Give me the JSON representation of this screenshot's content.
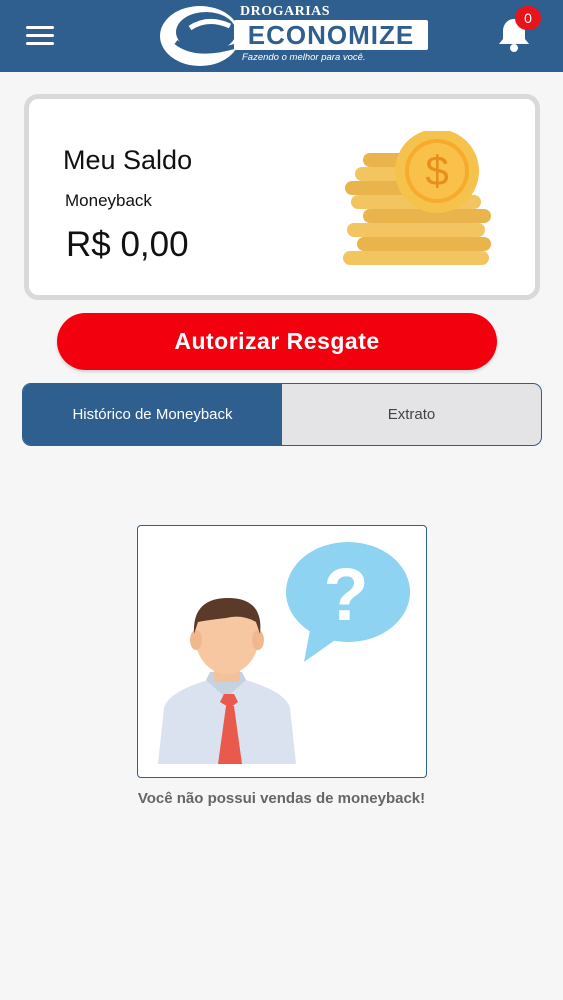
{
  "header": {
    "logo": {
      "top_text": "DROGARIAS",
      "main_text": "ECONOMIZE",
      "tagline": "Fazendo o melhor para você."
    },
    "notification_count": "0",
    "icons": [
      "menu-icon",
      "bell-icon"
    ]
  },
  "balance_card": {
    "title": "Meu Saldo",
    "subtitle": "Moneyback",
    "value": "R$ 0,00",
    "illustration": "coins-icon"
  },
  "actions": {
    "redeem_label": "Autorizar Resgate"
  },
  "tabs": [
    {
      "label": "Histórico de Moneyback",
      "active": true
    },
    {
      "label": "Extrato",
      "active": false
    }
  ],
  "empty_state": {
    "illustration": "person-question-icon",
    "message": "Você não possui vendas de moneyback!"
  },
  "colors": {
    "primary": "#2f5f8f",
    "accent": "#f2000d",
    "badge": "#e8141b",
    "background": "#f6f6f7"
  }
}
